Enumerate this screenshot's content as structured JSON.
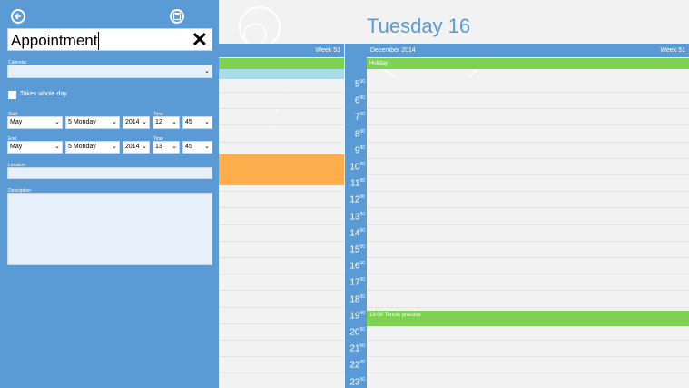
{
  "form": {
    "title_value": "Appointment",
    "calendar_label": "Calendar",
    "whole_day_label": "Takes whole day",
    "start_label": "Start",
    "end_label": "End",
    "time_label": "Time",
    "location_label": "Location",
    "description_label": "Description",
    "start": {
      "month": "May",
      "day": "5 Monday",
      "year": "2014",
      "hour": "12",
      "minute": "45"
    },
    "end": {
      "month": "May",
      "day": "5 Monday",
      "year": "2014",
      "hour": "13",
      "minute": "45"
    }
  },
  "calendar": {
    "date_title": "Tuesday 16",
    "month": "December 2014",
    "week_left": "Week 51",
    "week_right": "Week 51",
    "hours": [
      "5",
      "6",
      "7",
      "8",
      "9",
      "10",
      "11",
      "12",
      "13",
      "14",
      "15",
      "16",
      "17",
      "18",
      "19",
      "20",
      "21",
      "22",
      "23"
    ],
    "minute_suffix": "00",
    "holiday_event": "Holiday",
    "tennis_event": "19:00 Tennis practise",
    "colors": {
      "accent": "#5b9bd5",
      "green": "#7fd151",
      "orange": "#fdad4b",
      "teal": "#a8dce8"
    }
  }
}
